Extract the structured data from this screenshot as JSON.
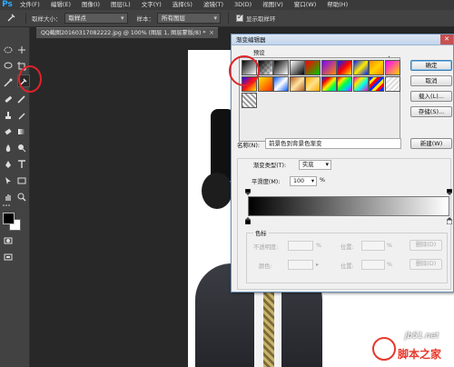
{
  "app": {
    "logo": "Ps"
  },
  "menu": [
    "文件(F)",
    "编辑(E)",
    "图像(I)",
    "图层(L)",
    "文字(Y)",
    "选择(S)",
    "滤镜(T)",
    "3D(D)",
    "视图(V)",
    "窗口(W)",
    "帮助(H)"
  ],
  "options_bar": {
    "sample_size_label": "取样大小：",
    "sample_size_value": "取样点",
    "sample_label": "样本：",
    "sample_value": "所有图层",
    "show_ring_label": "显示取样环"
  },
  "document_tab": {
    "title": "QQ截图20160317082222.jpg @ 100% (图层 1, 图层蒙版/8) *",
    "close": "×"
  },
  "gradient_editor": {
    "title": "渐变编辑器",
    "presets_label": "预设",
    "gear": "✲",
    "buttons": {
      "ok": "确定",
      "cancel": "取消",
      "load": "载入(L)...",
      "save": "存储(S)...",
      "new": "新建(W)"
    },
    "name_label": "名称(N):",
    "name_value": "前景色到背景色渐变",
    "gradient_type_label": "渐变类型(T):",
    "gradient_type_value": "实底",
    "smoothness_label": "平滑度(M):",
    "smoothness_value": "100",
    "smoothness_unit": "%",
    "stops_group": "色标",
    "opacity_label": "不透明度:",
    "location_label": "位置:",
    "delete_label": "删除(D)",
    "color_label": "颜色:",
    "percent": "%"
  },
  "watermark": {
    "site": "jb51.net",
    "name": "脚本之家"
  },
  "colors": {
    "accent_red": "#e0232a",
    "foreground": "#000000",
    "background": "#ffffff"
  }
}
